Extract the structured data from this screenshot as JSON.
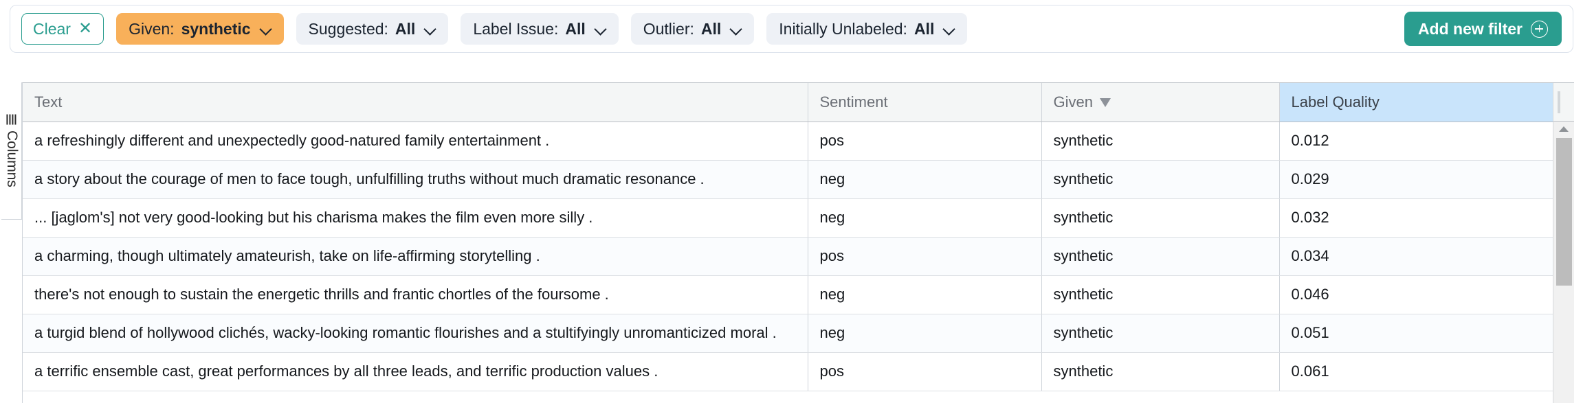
{
  "filter_bar": {
    "clear": {
      "label": "Clear",
      "icon": "close-icon",
      "glyph": "✕"
    },
    "filters": [
      {
        "label": "Given:",
        "value": "synthetic",
        "active": true
      },
      {
        "label": "Suggested:",
        "value": "All",
        "active": false
      },
      {
        "label": "Label Issue:",
        "value": "All",
        "active": false
      },
      {
        "label": "Outlier:",
        "value": "All",
        "active": false
      },
      {
        "label": "Initially Unlabeled:",
        "value": "All",
        "active": false
      }
    ],
    "add_filter": {
      "label": "Add new filter",
      "icon": "plus-circle-icon"
    },
    "accent_teal": "#2a9d8f",
    "accent_orange": "#f8b05a",
    "chip_bg": "#eef1f6"
  },
  "columns_rail": {
    "label": "Columns",
    "icon": "grip-lines-icon"
  },
  "table": {
    "headers": [
      {
        "label": "Text",
        "icon": null,
        "highlight": false
      },
      {
        "label": "Sentiment",
        "icon": null,
        "highlight": false
      },
      {
        "label": "Given",
        "icon": "filter-funnel-icon",
        "highlight": false
      },
      {
        "label": "Label Quality",
        "icon": null,
        "highlight": true
      }
    ],
    "highlight_color": "#c9e4fb",
    "rows": [
      {
        "text": "a refreshingly different and unexpectedly good-natured family entertainment .",
        "sentiment": "pos",
        "given": "synthetic",
        "label_quality": "0.012"
      },
      {
        "text": "a story about the courage of men to face tough, unfulfilling truths without much dramatic resonance .",
        "sentiment": "neg",
        "given": "synthetic",
        "label_quality": "0.029"
      },
      {
        "text": "... [jaglom's] not very good-looking but his charisma makes the film even more silly .",
        "sentiment": "neg",
        "given": "synthetic",
        "label_quality": "0.032"
      },
      {
        "text": "a charming, though ultimately amateurish, take on life-affirming storytelling .",
        "sentiment": "pos",
        "given": "synthetic",
        "label_quality": "0.034"
      },
      {
        "text": "there's not enough to sustain the energetic thrills and frantic chortles of the foursome .",
        "sentiment": "neg",
        "given": "synthetic",
        "label_quality": "0.046"
      },
      {
        "text": "a turgid blend of hollywood clichés, wacky-looking romantic flourishes and a stultifyingly unromanticized moral .",
        "sentiment": "neg",
        "given": "synthetic",
        "label_quality": "0.051"
      },
      {
        "text": "a terrific ensemble cast, great performances by all three leads, and terrific production values .",
        "sentiment": "pos",
        "given": "synthetic",
        "label_quality": "0.061"
      }
    ]
  },
  "scrollbar": {
    "up_icon": "caret-up-icon"
  }
}
